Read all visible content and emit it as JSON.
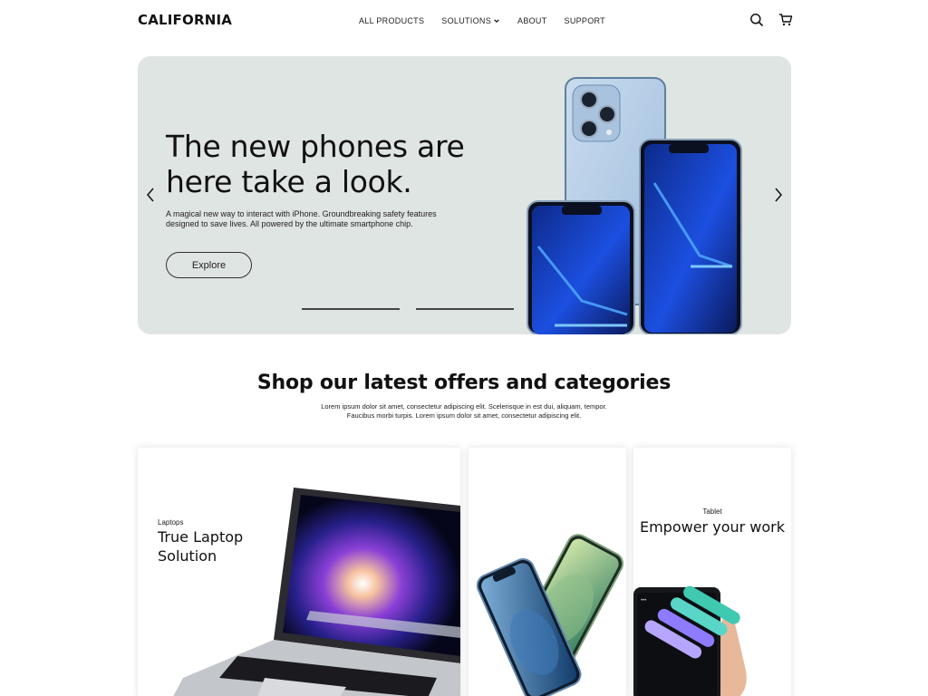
{
  "header": {
    "logo": "CALIFORNIA",
    "nav": [
      {
        "label": "ALL PRODUCTS"
      },
      {
        "label": "SOLUTIONS"
      },
      {
        "label": "ABOUT"
      },
      {
        "label": "SUPPORT"
      }
    ],
    "icons": [
      "search-icon",
      "cart-icon"
    ]
  },
  "hero": {
    "title": "The new phones are here take a look.",
    "subtitle": "A magical new way to interact with iPhone. Groundbreaking safety features designed to save lives. All powered by the ultimate smartphone chip.",
    "button_label": "Explore",
    "slides": 3,
    "active_slide": 3,
    "background": "#dfe5e2"
  },
  "section": {
    "title": "Shop our latest offers and categories",
    "subtitle": "Lorem ipsum dolor sit amet, consectetur adipiscing elit. Scelerisque in est dui, aliquam, tempor. Faucibus morbi turpis. Lorem ipsum dolor sit amet, consectetur adipiscing elit."
  },
  "cards": [
    {
      "category": "Laptops",
      "title": "True Laptop Solution"
    },
    {
      "category": "",
      "title": ""
    },
    {
      "category": "Tablet",
      "title": "Empower your work"
    }
  ]
}
